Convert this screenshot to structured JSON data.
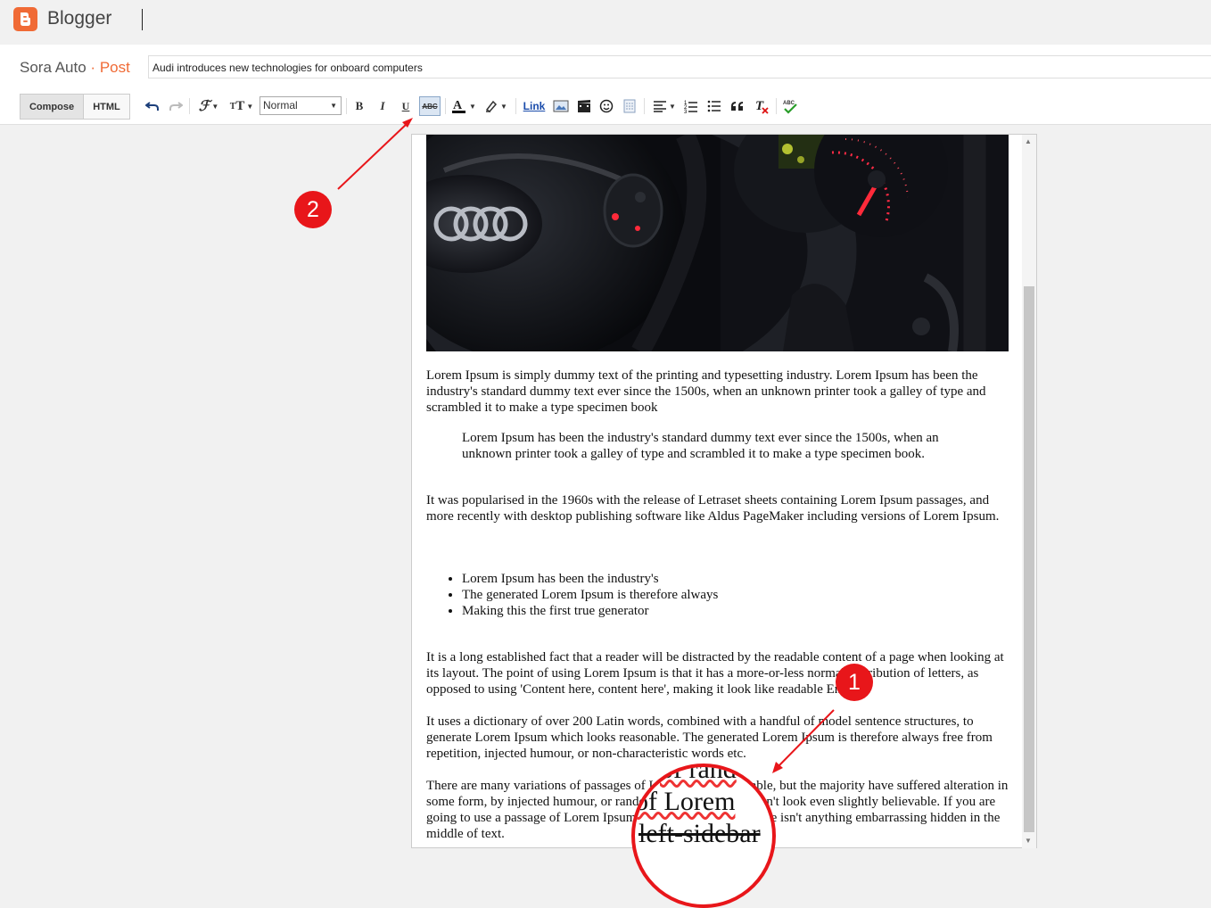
{
  "app": {
    "name": "Blogger"
  },
  "post_header": {
    "blog_name": "Sora Auto",
    "separator": "·",
    "post_label": "Post",
    "title_value": "Audi introduces new technologies for onboard computers"
  },
  "toolbar": {
    "compose_label": "Compose",
    "html_label": "HTML",
    "format_value": "Normal",
    "bold": "B",
    "italic": "I",
    "underline": "U",
    "strikethrough": "ABC",
    "link_label": "Link",
    "spellcheck": "ABC",
    "icons": [
      "undo-icon",
      "redo-icon",
      "font-family-icon",
      "font-size-icon",
      "text-color-icon",
      "highlight-icon",
      "image-icon",
      "video-icon",
      "emoji-icon",
      "jump-break-icon",
      "align-icon",
      "numbered-list-icon",
      "bullet-list-icon",
      "quote-icon",
      "clear-formatting-icon",
      "spellcheck-icon"
    ]
  },
  "editor": {
    "p1": "Lorem Ipsum is simply dummy text of the printing and typesetting industry. Lorem Ipsum has been the industry's standard dummy text ever since the 1500s, when an unknown printer took a galley of type and scrambled it to make a type specimen book",
    "blockquote": "Lorem Ipsum has been the industry's standard dummy text ever since the 1500s, when an unknown printer took a galley of type and scrambled it to make a type specimen book.",
    "p2": "It was popularised in the 1960s with the release of Letraset sheets containing Lorem Ipsum passages, and more recently with desktop publishing software like Aldus PageMaker including versions of Lorem Ipsum.",
    "list": [
      "Lorem Ipsum has been the industry's",
      "The generated Lorem Ipsum is therefore always",
      "Making this the first true generator"
    ],
    "p3": "It is a long established fact that a reader will be distracted by the readable content of a page when looking at its layout. The point of using Lorem Ipsum is that it has a more-or-less normal distribution of letters, as opposed to using 'Content here, content here', making it look like readable English.",
    "p4": "It uses a dictionary of over 200 Latin words, combined with a handful of model sentence structures, to generate Lorem Ipsum which looks reasonable. The generated Lorem Ipsum is therefore always free from repetition, injected humour, or non-characteristic words etc.",
    "p5": "There are many variations of passages of Lorem Ipsum available, but the majority have suffered alteration in some form, by injected humour, or randomised words which don't look even slightly believable. If you are going to use a passage of Lorem Ipsum, you need to be sure there isn't anything embarrassing hidden in the middle of text."
  },
  "annotations": {
    "badge1": "1",
    "badge2": "2",
    "mag_line1": "of Lorem",
    "mag_line2": "left-sidebar",
    "mag_line0": "of rand"
  },
  "colors": {
    "brand": "#f06a35",
    "annotation": "#e8161a",
    "link": "#1a4cab"
  }
}
